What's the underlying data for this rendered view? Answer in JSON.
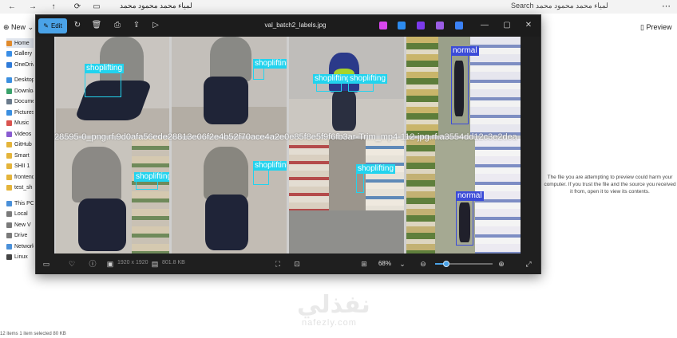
{
  "explorer": {
    "address": "لمياء محمد محمود محمد",
    "search": "Search لمياء محمد محمود محمد",
    "new_label": "New",
    "preview_label": "Preview",
    "sidebar": [
      {
        "label": "Home",
        "color": "#e08a2c"
      },
      {
        "label": "Gallery",
        "color": "#3a8ee6"
      },
      {
        "label": "OneDrive",
        "color": "#2f7bd9"
      },
      {
        "label": "Desktop",
        "color": "#3b8fe0"
      },
      {
        "label": "Downloads",
        "color": "#3aa26b"
      },
      {
        "label": "Documents",
        "color": "#6b7b8c"
      },
      {
        "label": "Pictures",
        "color": "#3b8fe0"
      },
      {
        "label": "Music",
        "color": "#d9534f"
      },
      {
        "label": "Videos",
        "color": "#8a5cd1"
      },
      {
        "label": "GitHub",
        "color": "#e4b43a"
      },
      {
        "label": "Smart",
        "color": "#e4b43a"
      },
      {
        "label": "SHII 1",
        "color": "#e4b43a"
      },
      {
        "label": "frontend",
        "color": "#e4b43a"
      },
      {
        "label": "test_sh",
        "color": "#e4b43a"
      },
      {
        "label": "This PC",
        "color": "#4a90d9"
      },
      {
        "label": "Local",
        "color": "#7a7a7a"
      },
      {
        "label": "New V",
        "color": "#7a7a7a"
      },
      {
        "label": "Drive",
        "color": "#7a7a7a"
      },
      {
        "label": "Network",
        "color": "#4a90d9"
      },
      {
        "label": "Linux",
        "color": "#444444"
      }
    ],
    "preview_warning": "The file you are attempting to preview could harm your computer. If you trust the file and the source you received it from, open it to view its contents.",
    "status": "12 items    1 item selected  80 KB",
    "watermark_ar": "نفذلي",
    "watermark_latin": "nafezly.com"
  },
  "photos": {
    "edit_label": "Edit",
    "file_title": "val_batch2_labels.jpg",
    "toolbar_icons": [
      "rotate-icon",
      "delete-icon",
      "print-icon",
      "share-icon",
      "slideshow-icon"
    ],
    "app_icons": [
      {
        "name": "copilot-icon",
        "color": "#d946ef"
      },
      {
        "name": "designer-icon",
        "color": "#2d8cf0"
      },
      {
        "name": "clipchamp-icon",
        "color": "#7c3aed"
      },
      {
        "name": "onenote-icon",
        "color": "#9b5de5"
      },
      {
        "name": "onedrive-icon",
        "color": "#3b82f6"
      }
    ],
    "dimensions": "1920 x 1920",
    "file_size": "801.8 KB",
    "zoom": "68%",
    "zoom_fraction": 0.2,
    "overlap_caption": "28595-0_png.rf.9d0afa56ede28813e06f2e4b52f70ace4a2e0e85f8e5f9f6fb3ar-Trim_mp4-112-jpg.rf.a3554dd12c3e2dea",
    "detections": [
      {
        "tile": 0,
        "label": "shoplifting",
        "kind": "shoplifting"
      },
      {
        "tile": 1,
        "label": "shoplifting",
        "kind": "shoplifting"
      },
      {
        "tile": 2,
        "label": "shoplifting",
        "kind": "shoplifting"
      },
      {
        "tile": 2,
        "label": "shoplifting",
        "kind": "shoplifting"
      },
      {
        "tile": 3,
        "label": "normal",
        "kind": "normal"
      },
      {
        "tile": 4,
        "label": "shoplifting",
        "kind": "shoplifting"
      },
      {
        "tile": 5,
        "label": "shoplifting",
        "kind": "shoplifting"
      },
      {
        "tile": 6,
        "label": "shoplifting",
        "kind": "shoplifting"
      },
      {
        "tile": 7,
        "label": "normal",
        "kind": "normal"
      }
    ]
  }
}
